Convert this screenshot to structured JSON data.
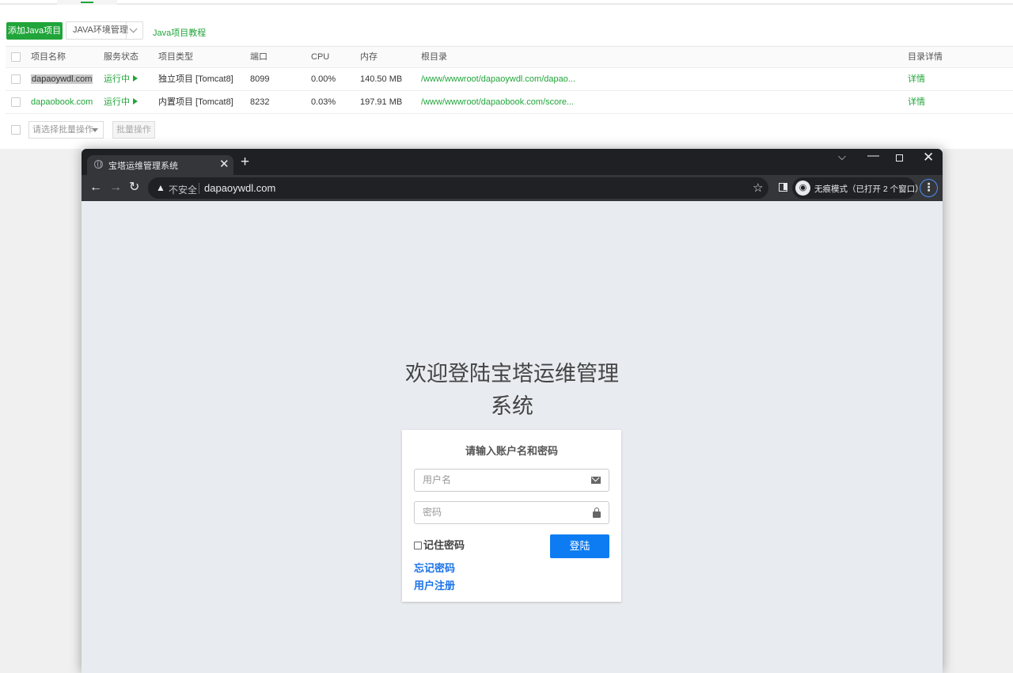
{
  "panel": {
    "add_button": "添加Java项目",
    "env_button": "JAVA环境管理",
    "tutorial_link": "Java项目教程",
    "table": {
      "headers": [
        "项目名称",
        "服务状态",
        "项目类型",
        "端口",
        "CPU",
        "内存",
        "根目录",
        "目录详情"
      ],
      "rows": [
        {
          "name": "dapaoywdl.com",
          "status": "运行中",
          "type": "独立项目 [Tomcat8]",
          "port": "8099",
          "cpu": "0.00%",
          "mem": "140.50 MB",
          "root": "/www/wwwroot/dapaoywdl.com/dapao...",
          "detail": "详情"
        },
        {
          "name": "dapaobook.com",
          "status": "运行中",
          "type": "内置项目 [Tomcat8]",
          "port": "8232",
          "cpu": "0.03%",
          "mem": "197.91 MB",
          "root": "/www/wwwroot/dapaobook.com/score...",
          "detail": "详情"
        }
      ]
    },
    "batch_placeholder": "请选择批量操作",
    "batch_button": "批量操作"
  },
  "browser": {
    "tab_title": "宝塔运维管理系统",
    "tab_close": "✕",
    "new_tab": "+",
    "insecure_label": "不安全",
    "url": "dapaoywdl.com",
    "incognito_label": "无痕模式（已打开 2 个窗口）",
    "icons": {
      "back": "back-arrow-icon",
      "forward": "forward-arrow-icon",
      "reload": "reload-icon",
      "star": "star-icon",
      "menu": "more-vert-icon"
    }
  },
  "login": {
    "title_line1": "欢迎登陆宝塔运维管理",
    "title_line2": "系统",
    "subtitle": "请输入账户名和密码",
    "username_placeholder": "用户名",
    "password_placeholder": "密码",
    "remember_label": "记住密码",
    "login_button": "登陆",
    "forgot_link": "忘记密码",
    "register_link": "用户注册"
  },
  "colors": {
    "accent_green": "#20a53a",
    "login_blue": "#0d7cf2",
    "link_blue": "#1a73e8"
  }
}
